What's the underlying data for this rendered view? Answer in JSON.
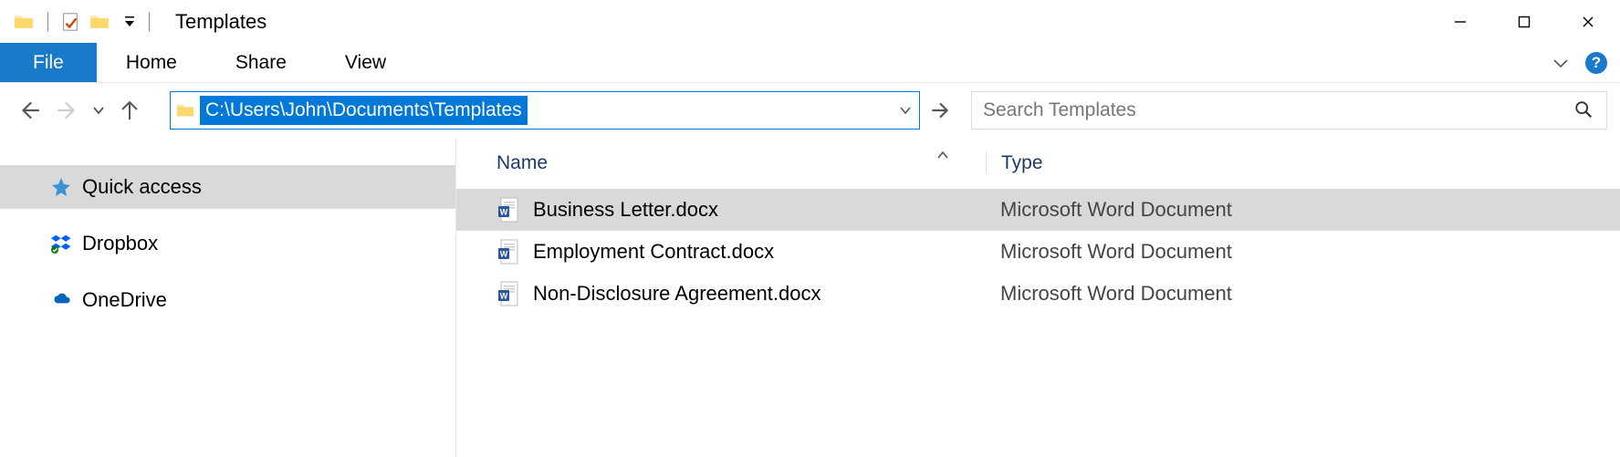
{
  "window": {
    "title": "Templates"
  },
  "ribbon": {
    "file": "File",
    "tabs": [
      "Home",
      "Share",
      "View"
    ],
    "help": "?"
  },
  "nav": {
    "path": "C:\\Users\\John\\Documents\\Templates",
    "search_placeholder": "Search Templates"
  },
  "sidebar": {
    "items": [
      {
        "label": "Quick access",
        "icon": "star"
      },
      {
        "label": "Dropbox",
        "icon": "dropbox"
      },
      {
        "label": "OneDrive",
        "icon": "onedrive"
      }
    ]
  },
  "columns": {
    "name": "Name",
    "type": "Type"
  },
  "files": [
    {
      "name": "Business Letter.docx",
      "type": "Microsoft Word Document",
      "selected": true
    },
    {
      "name": "Employment Contract.docx",
      "type": "Microsoft Word Document",
      "selected": false
    },
    {
      "name": "Non-Disclosure Agreement.docx",
      "type": "Microsoft Word Document",
      "selected": false
    }
  ]
}
